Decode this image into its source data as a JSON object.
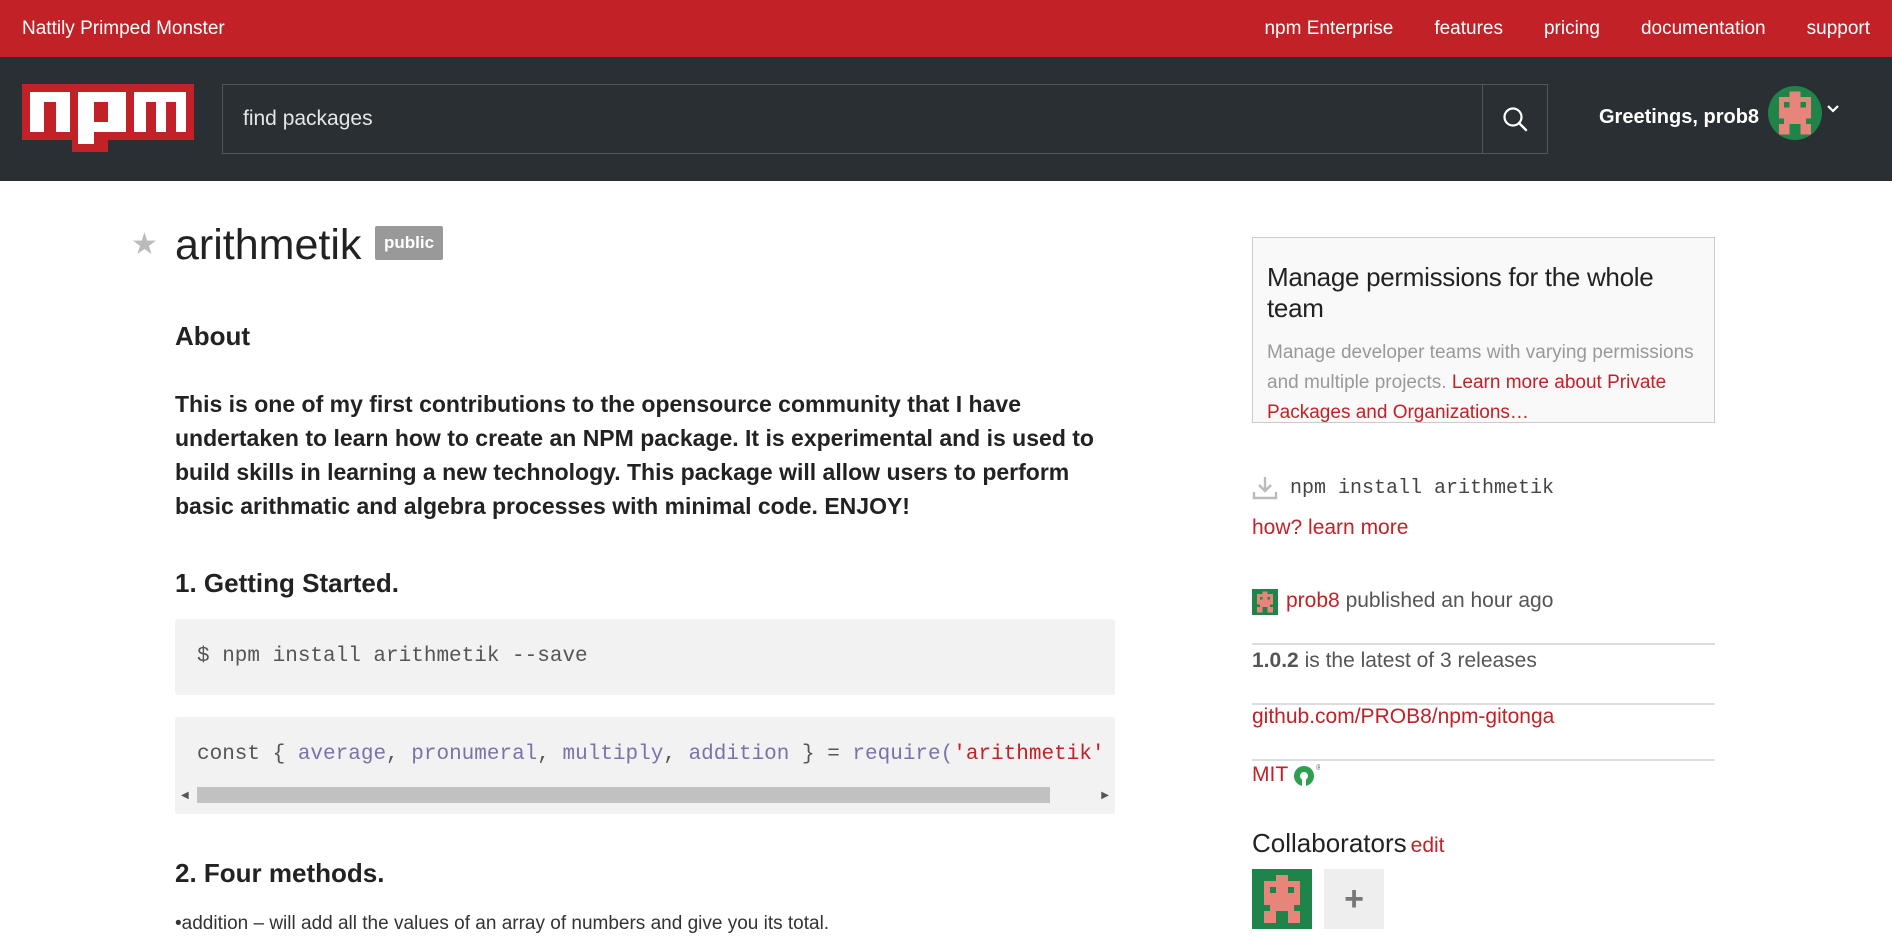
{
  "topbar": {
    "tagline": "Nattily Primped Monster",
    "nav": [
      "npm Enterprise",
      "features",
      "pricing",
      "documentation",
      "support"
    ]
  },
  "header": {
    "search_placeholder": "find packages",
    "greeting": "Greetings, prob8"
  },
  "package": {
    "name": "arithmetik",
    "visibility": "public",
    "about_heading": "About",
    "about_text": "This is one of my first contributions to the opensource community that I have undertaken to learn how to create an NPM package. It is experimental and is used to build skills in learning a new technology. This package will allow users to perform basic arithmatic and algebra processes with minimal code. ENJOY!",
    "getting_started_heading": "1. Getting Started.",
    "code1": "$ npm install arithmetik --save",
    "code2": {
      "kw": "const",
      "open": " { ",
      "vars": [
        "average",
        "pronumeral",
        "multiply",
        "addition"
      ],
      "close": " } = ",
      "fn": "require(",
      "str": "'arithmetik'"
    },
    "four_methods_heading": "2. Four methods.",
    "four_methods_item": "•addition – will add all the values of an array of numbers and give you its total."
  },
  "sidebar": {
    "ad_title": "Manage permissions for the whole team",
    "ad_text": "Manage developer teams with varying permissions and multiple projects.",
    "ad_link": "Learn more about Private Packages and Organizations…",
    "install_cmd": "npm install arithmetik",
    "how_link": "how? learn more",
    "publisher": "prob8",
    "published_text": "published an hour ago",
    "version": "1.0.2",
    "version_text": "is the latest of 3 releases",
    "repo": "github.com/PROB8/npm-gitonga",
    "license": "MIT",
    "collaborators_heading": "Collaborators",
    "edit_label": "edit",
    "add_symbol": "+"
  },
  "colors": {
    "brand_red": "#c12127",
    "header_dark": "#2a2f33",
    "avatar_green": "#1e8449",
    "avatar_pink": "#e8857a"
  }
}
